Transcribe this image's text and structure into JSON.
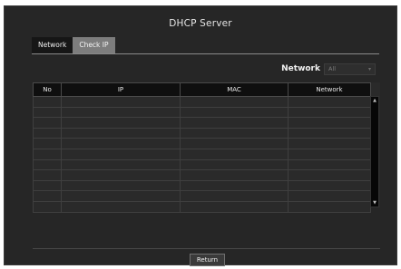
{
  "window": {
    "title": "DHCP Server"
  },
  "tabs": [
    {
      "label": "Network",
      "active": true
    },
    {
      "label": "Check IP",
      "active": false
    }
  ],
  "filter": {
    "label": "Network",
    "selected": "All"
  },
  "table": {
    "columns": [
      "No",
      "IP",
      "MAC",
      "Network"
    ],
    "rows": [
      [
        "",
        "",
        "",
        ""
      ],
      [
        "",
        "",
        "",
        ""
      ],
      [
        "",
        "",
        "",
        ""
      ],
      [
        "",
        "",
        "",
        ""
      ],
      [
        "",
        "",
        "",
        ""
      ],
      [
        "",
        "",
        "",
        ""
      ],
      [
        "",
        "",
        "",
        ""
      ],
      [
        "",
        "",
        "",
        ""
      ],
      [
        "",
        "",
        "",
        ""
      ],
      [
        "",
        "",
        "",
        ""
      ],
      [
        "",
        "",
        "",
        ""
      ]
    ]
  },
  "buttons": {
    "return_label": "Return"
  },
  "icons": {
    "scroll_up": "arrow-up-icon",
    "scroll_down": "arrow-down-icon",
    "dropdown": "chevron-down-icon"
  }
}
